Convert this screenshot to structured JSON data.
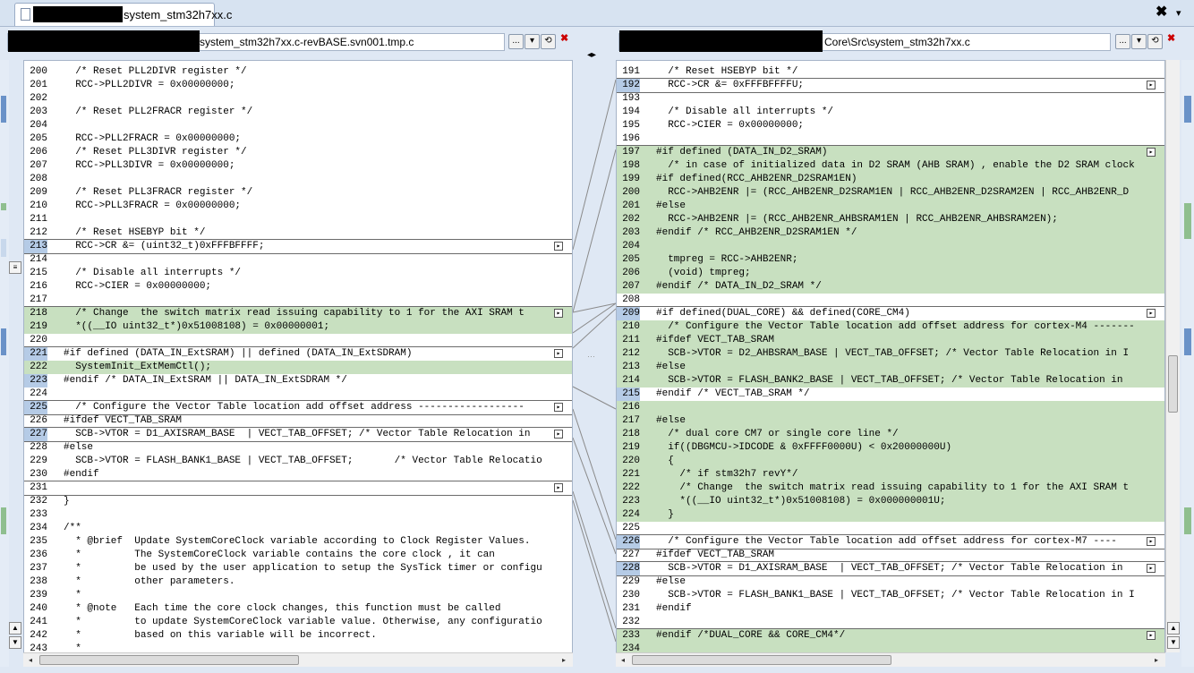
{
  "tab": {
    "title": "system_stm32h7xx.c",
    "close_icon": "✖",
    "dropdown_icon": "▾"
  },
  "left_path": {
    "text": "system_stm32h7xx.c-revBASE.svn001.tmp.c",
    "btn_browse": "...",
    "btn_drop": "▾",
    "btn_refresh": "⟲"
  },
  "right_path": {
    "text": "Core\\Src\\system_stm32h7xx.c",
    "btn_browse": "...",
    "btn_drop": "▾",
    "btn_refresh": "⟲"
  },
  "swap_icon": "◂▸",
  "left_lines": [
    {
      "n": "200",
      "t": "  /* Reset PLL2DIVR register */",
      "cls": "cm"
    },
    {
      "n": "201",
      "t": "  RCC->PLL2DIVR = 0x00000000;",
      "cls": ""
    },
    {
      "n": "202",
      "t": "",
      "cls": ""
    },
    {
      "n": "203",
      "t": "  /* Reset PLL2FRACR register */",
      "cls": "cm"
    },
    {
      "n": "204",
      "t": "",
      "cls": ""
    },
    {
      "n": "205",
      "t": "  RCC->PLL2FRACR = 0x00000000;",
      "cls": ""
    },
    {
      "n": "206",
      "t": "  /* Reset PLL3DIVR register */",
      "cls": "cm"
    },
    {
      "n": "207",
      "t": "  RCC->PLL3DIVR = 0x00000000;",
      "cls": ""
    },
    {
      "n": "208",
      "t": "",
      "cls": ""
    },
    {
      "n": "209",
      "t": "  /* Reset PLL3FRACR register */",
      "cls": "cm"
    },
    {
      "n": "210",
      "t": "  RCC->PLL3FRACR = 0x00000000;",
      "cls": ""
    },
    {
      "n": "211",
      "t": "",
      "cls": ""
    },
    {
      "n": "212",
      "t": "  /* Reset HSEBYP bit */",
      "cls": "cm"
    },
    {
      "n": "213",
      "t": "  RCC->CR &= (uint32_t)0xFFFBFFFF;",
      "cls": "",
      "hl": "b",
      "box": true
    },
    {
      "n": "214",
      "t": "",
      "cls": ""
    },
    {
      "n": "215",
      "t": "  /* Disable all interrupts */",
      "cls": "cm"
    },
    {
      "n": "216",
      "t": "  RCC->CIER = 0x00000000;",
      "cls": ""
    },
    {
      "n": "217",
      "t": "",
      "cls": ""
    },
    {
      "n": "218",
      "t": "  /* Change  the switch matrix read issuing capability to 1 for the AXI SRAM t",
      "cls": "cm",
      "hl": "g",
      "box": true
    },
    {
      "n": "219",
      "t": "  *((__IO uint32_t*)0x51008108) = 0x00000001;",
      "cls": "",
      "hl": "g"
    },
    {
      "n": "220",
      "t": "",
      "cls": ""
    },
    {
      "n": "221",
      "t": "#if defined (DATA_IN_ExtSRAM) || defined (DATA_IN_ExtSDRAM)",
      "cls": "",
      "hl": "b",
      "box": true
    },
    {
      "n": "222",
      "t": "  SystemInit_ExtMemCtl();",
      "cls": "",
      "hl": "g"
    },
    {
      "n": "223",
      "t": "#endif /* DATA_IN_ExtSRAM || DATA_IN_ExtSDRAM */",
      "cls": "",
      "hl": "b"
    },
    {
      "n": "224",
      "t": "",
      "cls": ""
    },
    {
      "n": "225",
      "t": "  /* Configure the Vector Table location add offset address ------------------",
      "cls": "cm",
      "hl": "b",
      "box": true
    },
    {
      "n": "226",
      "t": "#ifdef VECT_TAB_SRAM",
      "cls": ""
    },
    {
      "n": "227",
      "t": "  SCB->VTOR = D1_AXISRAM_BASE  | VECT_TAB_OFFSET; /* Vector Table Relocation in",
      "cls": "",
      "hl": "b",
      "box": true
    },
    {
      "n": "228",
      "t": "#else",
      "cls": ""
    },
    {
      "n": "229",
      "t": "  SCB->VTOR = FLASH_BANK1_BASE | VECT_TAB_OFFSET;       /* Vector Table Relocatio",
      "cls": ""
    },
    {
      "n": "230",
      "t": "#endif",
      "cls": ""
    },
    {
      "n": "231",
      "t": "",
      "cls": "",
      "box": true
    },
    {
      "n": "232",
      "t": "}",
      "cls": ""
    },
    {
      "n": "233",
      "t": "",
      "cls": ""
    },
    {
      "n": "234",
      "t": "/**",
      "cls": "cm"
    },
    {
      "n": "235",
      "t": "  * @brief  Update SystemCoreClock variable according to Clock Register Values.",
      "cls": "cm"
    },
    {
      "n": "236",
      "t": "  *         The SystemCoreClock variable contains the core clock , it can",
      "cls": "cm"
    },
    {
      "n": "237",
      "t": "  *         be used by the user application to setup the SysTick timer or configu",
      "cls": "cm"
    },
    {
      "n": "238",
      "t": "  *         other parameters.",
      "cls": "cm"
    },
    {
      "n": "239",
      "t": "  *",
      "cls": "cm"
    },
    {
      "n": "240",
      "t": "  * @note   Each time the core clock changes, this function must be called",
      "cls": "cm"
    },
    {
      "n": "241",
      "t": "  *         to update SystemCoreClock variable value. Otherwise, any configuratio",
      "cls": "cm"
    },
    {
      "n": "242",
      "t": "  *         based on this variable will be incorrect.",
      "cls": "cm"
    },
    {
      "n": "243",
      "t": "  *",
      "cls": "cm"
    }
  ],
  "right_lines": [
    {
      "n": "191",
      "t": "  /* Reset HSEBYP bit */",
      "cls": "cm"
    },
    {
      "n": "192",
      "t": "  RCC->CR &= 0xFFFBFFFFU;",
      "cls": "",
      "hl": "b",
      "box": true
    },
    {
      "n": "193",
      "t": "",
      "cls": ""
    },
    {
      "n": "194",
      "t": "  /* Disable all interrupts */",
      "cls": "cm"
    },
    {
      "n": "195",
      "t": "  RCC->CIER = 0x00000000;",
      "cls": ""
    },
    {
      "n": "196",
      "t": "",
      "cls": ""
    },
    {
      "n": "197",
      "t": "#if defined (DATA_IN_D2_SRAM)",
      "cls": "",
      "hl": "g",
      "box": true
    },
    {
      "n": "198",
      "t": "  /* in case of initialized data in D2 SRAM (AHB SRAM) , enable the D2 SRAM clock",
      "cls": "cm",
      "hl": "g"
    },
    {
      "n": "199",
      "t": "#if defined(RCC_AHB2ENR_D2SRAM1EN)",
      "cls": "",
      "hl": "g"
    },
    {
      "n": "200",
      "t": "  RCC->AHB2ENR |= (RCC_AHB2ENR_D2SRAM1EN | RCC_AHB2ENR_D2SRAM2EN | RCC_AHB2ENR_D",
      "cls": "",
      "hl": "g"
    },
    {
      "n": "201",
      "t": "#else",
      "cls": "",
      "hl": "g"
    },
    {
      "n": "202",
      "t": "  RCC->AHB2ENR |= (RCC_AHB2ENR_AHBSRAM1EN | RCC_AHB2ENR_AHBSRAM2EN);",
      "cls": "",
      "hl": "g"
    },
    {
      "n": "203",
      "t": "#endif /* RCC_AHB2ENR_D2SRAM1EN */",
      "cls": "",
      "hl": "g"
    },
    {
      "n": "204",
      "t": "",
      "cls": "",
      "hl": "g"
    },
    {
      "n": "205",
      "t": "  tmpreg = RCC->AHB2ENR;",
      "cls": "",
      "hl": "g"
    },
    {
      "n": "206",
      "t": "  (void) tmpreg;",
      "cls": "",
      "hl": "g"
    },
    {
      "n": "207",
      "t": "#endif /* DATA_IN_D2_SRAM */",
      "cls": "",
      "hl": "g"
    },
    {
      "n": "208",
      "t": "",
      "cls": ""
    },
    {
      "n": "209",
      "t": "#if defined(DUAL_CORE) && defined(CORE_CM4)",
      "cls": "",
      "hl": "b",
      "box": true
    },
    {
      "n": "210",
      "t": "  /* Configure the Vector Table location add offset address for cortex-M4 -------",
      "cls": "cm",
      "hl": "g"
    },
    {
      "n": "211",
      "t": "#ifdef VECT_TAB_SRAM",
      "cls": "",
      "hl": "g"
    },
    {
      "n": "212",
      "t": "  SCB->VTOR = D2_AHBSRAM_BASE | VECT_TAB_OFFSET; /* Vector Table Relocation in I",
      "cls": "",
      "hl": "g"
    },
    {
      "n": "213",
      "t": "#else",
      "cls": "",
      "hl": "g"
    },
    {
      "n": "214",
      "t": "  SCB->VTOR = FLASH_BANK2_BASE | VECT_TAB_OFFSET; /* Vector Table Relocation in",
      "cls": "",
      "hl": "g"
    },
    {
      "n": "215",
      "t": "#endif /* VECT_TAB_SRAM */",
      "cls": "",
      "hl": "b"
    },
    {
      "n": "216",
      "t": "",
      "cls": "",
      "hl": "g"
    },
    {
      "n": "217",
      "t": "#else",
      "cls": "",
      "hl": "g"
    },
    {
      "n": "218",
      "t": "  /* dual core CM7 or single core line */",
      "cls": "cm",
      "hl": "g"
    },
    {
      "n": "219",
      "t": "  if((DBGMCU->IDCODE & 0xFFFF0000U) < 0x20000000U)",
      "cls": "",
      "hl": "g"
    },
    {
      "n": "220",
      "t": "  {",
      "cls": "",
      "hl": "g"
    },
    {
      "n": "221",
      "t": "    /* if stm32h7 revY*/",
      "cls": "cm",
      "hl": "g"
    },
    {
      "n": "222",
      "t": "    /* Change  the switch matrix read issuing capability to 1 for the AXI SRAM t",
      "cls": "cm",
      "hl": "g"
    },
    {
      "n": "223",
      "t": "    *((__IO uint32_t*)0x51008108) = 0x000000001U;",
      "cls": "",
      "hl": "g"
    },
    {
      "n": "224",
      "t": "  }",
      "cls": "",
      "hl": "g"
    },
    {
      "n": "225",
      "t": "",
      "cls": ""
    },
    {
      "n": "226",
      "t": "  /* Configure the Vector Table location add offset address for cortex-M7 ----",
      "cls": "cm",
      "hl": "b",
      "box": true
    },
    {
      "n": "227",
      "t": "#ifdef VECT_TAB_SRAM",
      "cls": ""
    },
    {
      "n": "228",
      "t": "  SCB->VTOR = D1_AXISRAM_BASE  | VECT_TAB_OFFSET; /* Vector Table Relocation in",
      "cls": "",
      "hl": "b",
      "box": true
    },
    {
      "n": "229",
      "t": "#else",
      "cls": ""
    },
    {
      "n": "230",
      "t": "  SCB->VTOR = FLASH_BANK1_BASE | VECT_TAB_OFFSET; /* Vector Table Relocation in I",
      "cls": ""
    },
    {
      "n": "231",
      "t": "#endif",
      "cls": ""
    },
    {
      "n": "232",
      "t": "",
      "cls": ""
    },
    {
      "n": "233",
      "t": "#endif /*DUAL_CORE && CORE_CM4*/",
      "cls": "",
      "hl": "g",
      "box": true
    },
    {
      "n": "234",
      "t": "",
      "cls": "",
      "hl": "g"
    }
  ]
}
